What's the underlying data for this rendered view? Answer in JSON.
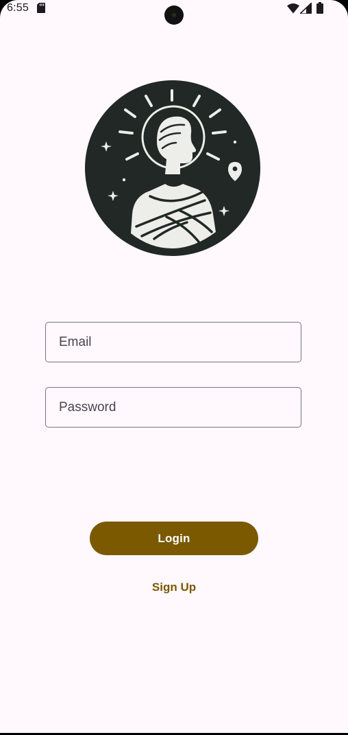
{
  "status_bar": {
    "time": "6:55",
    "icons": [
      "sd-card-icon",
      "wifi-icon",
      "signal-icon",
      "battery-icon"
    ]
  },
  "logo": {
    "icon": "statue-bust-logo",
    "colors": {
      "circle": "#212825",
      "figure": "#EDEEEA"
    }
  },
  "form": {
    "email_placeholder": "Email",
    "email_value": "",
    "password_placeholder": "Password",
    "password_value": ""
  },
  "actions": {
    "login_label": "Login",
    "signup_label": "Sign Up"
  },
  "colors": {
    "background": "#FFF8FC",
    "primary": "#7A5900",
    "outline": "#79747E",
    "on_primary": "#FFFFFF"
  }
}
